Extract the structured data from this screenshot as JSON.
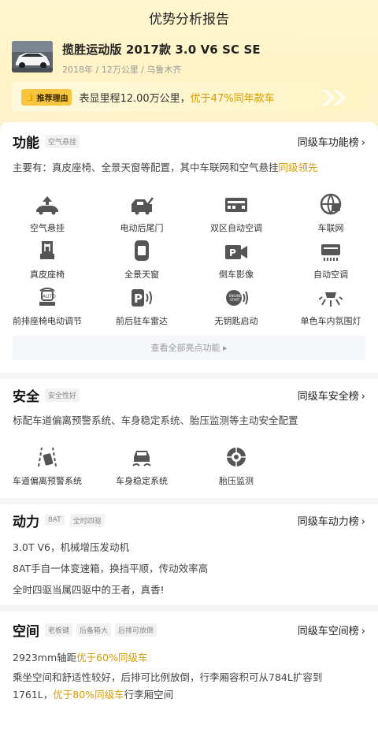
{
  "page": {
    "title": "优势分析报告"
  },
  "car": {
    "name": "揽胜运动版 2017款 3.0 V6 SC SE",
    "meta": "2018年 / 12万公里 / 乌鲁木齐"
  },
  "reason": {
    "badge": "推荐理由",
    "text_prefix": "表显里程12.00万公里，",
    "text_highlight": "优于47%同年款车"
  },
  "features": {
    "title": "功能",
    "tag": "空气悬挂",
    "rank_link": "同级车功能榜",
    "desc_prefix": "主要有：真皮座椅、全景天窗等配置，其中车联网和空气悬挂",
    "desc_highlight": "同级领先",
    "items": [
      {
        "label": "空气悬挂",
        "icon": "air-suspension-icon"
      },
      {
        "label": "电动后尾门",
        "icon": "power-tailgate-icon"
      },
      {
        "label": "双区自动空调",
        "icon": "dual-zone-ac-icon"
      },
      {
        "label": "车联网",
        "icon": "connected-car-icon"
      },
      {
        "label": "真皮座椅",
        "icon": "leather-seat-icon"
      },
      {
        "label": "全景天窗",
        "icon": "panoramic-sunroof-icon"
      },
      {
        "label": "倒车影像",
        "icon": "reverse-camera-icon"
      },
      {
        "label": "自动空调",
        "icon": "auto-ac-icon"
      },
      {
        "label": "前排座椅电动调节",
        "icon": "power-seat-icon"
      },
      {
        "label": "前后驻车雷达",
        "icon": "parking-radar-icon"
      },
      {
        "label": "无钥匙启动",
        "icon": "keyless-start-icon"
      },
      {
        "label": "单色车内氛围灯",
        "icon": "ambient-light-icon"
      }
    ],
    "more": "查看全部亮点功能"
  },
  "safety": {
    "title": "安全",
    "tag": "安全性好",
    "rank_link": "同级车安全榜",
    "desc": "标配车道偏离预警系统、车身稳定系统、胎压监测等主动安全配置",
    "items": [
      {
        "label": "车道偏离预警系统",
        "icon": "lane-departure-icon"
      },
      {
        "label": "车身稳定系统",
        "icon": "stability-control-icon"
      },
      {
        "label": "胎压监测",
        "icon": "tire-pressure-icon"
      }
    ]
  },
  "power": {
    "title": "动力",
    "tags": [
      "8AT",
      "全时四驱"
    ],
    "rank_link": "同级车动力榜",
    "lines": [
      "3.0T V6，机械增压发动机",
      "8AT手自一体变速箱，换挡平顺，传动效率高",
      "全时四驱当属四驱中的王者，真香!"
    ]
  },
  "space": {
    "title": "空间",
    "tags": [
      "老板键",
      "后备箱大",
      "后排可放倒"
    ],
    "rank_link": "同级车空间榜",
    "line1_prefix": "2923mm轴距",
    "line1_highlight": "优于60%同级车",
    "line2_a": "乘坐空间和舒适性较好，后排可比例放倒，行李厢容积可从784L扩容到",
    "line2_b_prefix": "1761L，",
    "line2_b_highlight": "优于80%同级车",
    "line2_b_suffix": "行李厢空间"
  },
  "colors": {
    "accent": "#d59b00",
    "badge": "#f7c53f",
    "header_bg": "#fff4c8"
  }
}
